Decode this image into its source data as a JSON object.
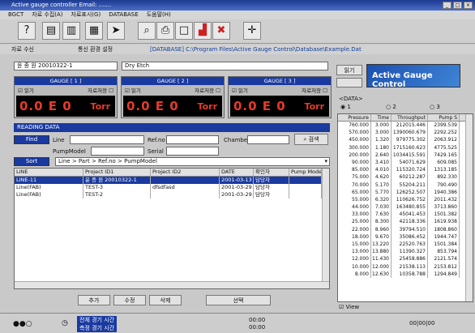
{
  "window": {
    "title": "Active gauge controller  Email: ......."
  },
  "menu": [
    "BGCT",
    "자료 수집(A)",
    "자료표시(G)",
    "DATABASE",
    "도움말(H)"
  ],
  "toolbar": {
    "icons": [
      "help-icon",
      "database-icon",
      "sheet-icon",
      "export-icon",
      "search-icon",
      "chart-icon",
      "display-icon",
      "close-icon",
      "crosshair-icon"
    ]
  },
  "pathbar": {
    "item1": "자료 수신",
    "item2": "통신 환경 설정",
    "path": "[DATABASE] C:\\Program Files\\Active Gauge Control\\Database\\Example.Dat"
  },
  "header": {
    "name": "윤 종 원 20010322-1",
    "process": "Dry Etch"
  },
  "gauges": [
    {
      "title": "GAUGE [ 1 ]",
      "read": "읽기",
      "save": "자료저장",
      "value": "0.0 E 0",
      "unit": "Torr"
    },
    {
      "title": "GAUGE [ 2 ]",
      "read": "읽기",
      "save": "자료저장",
      "value": "0.0 E 0",
      "unit": "Torr"
    },
    {
      "title": "GAUGE [ 3 ]",
      "read": "읽기",
      "save": "자료저장",
      "value": "0.0 E 0",
      "unit": "Torr"
    }
  ],
  "reading": {
    "title": "READING DATA",
    "find": "Find",
    "line": "Line",
    "refno": "Ref.no",
    "chamber": "Chamber",
    "pumpmodel": "PumpModel",
    "serial": "Serial",
    "search": "검색",
    "sort": "Sort",
    "sort_value": "Line > Part > Ref.no > PumpModel"
  },
  "grid": {
    "columns": [
      "LINE",
      "Project ID1",
      "Project ID2",
      "DATE",
      "확인자",
      "Pump Model"
    ],
    "rows": [
      {
        "line": "LINE-11",
        "id1": "윤 종 원 20010322-1",
        "id2": "",
        "date": "2001-03-13",
        "who": "담당자",
        "pump": ""
      },
      {
        "line": "Line(FAB)",
        "id1": "TEST-3",
        "id2": "dfsdfasd",
        "date": "2001-03-29",
        "who": "담당자",
        "pump": ""
      },
      {
        "line": "Line(FAB)",
        "id1": "TEST-2",
        "id2": "",
        "date": "2001-03-29",
        "who": "담당자",
        "pump": ""
      }
    ]
  },
  "buttons": {
    "add": "추가",
    "edit": "수정",
    "delete": "삭제",
    "select": "선택"
  },
  "right": {
    "read": "읽기",
    "logo": "Active Gauge Control",
    "data_label": "<DATA>",
    "radios": [
      "1",
      "2",
      "3"
    ],
    "view": "View"
  },
  "datatable": {
    "columns": [
      "Pressure",
      "Time",
      "Throughput",
      "Pump S"
    ],
    "rows": [
      [
        "760.000",
        "3.000",
        "212015.446",
        "2399.539"
      ],
      [
        "570.000",
        "3.000",
        "1390060.679",
        "2292.252"
      ],
      [
        "450.000",
        "1.320",
        "979775.302",
        "2063.912"
      ],
      [
        "300.000",
        "1.180",
        "1715160.623",
        "4775.525"
      ],
      [
        "200.000",
        "2.640",
        "1034415.591",
        "7429.165"
      ],
      [
        "90.000",
        "3.410",
        "54071.629",
        "609.085"
      ],
      [
        "85.000",
        "4.010",
        "115320.724",
        "1313.185"
      ],
      [
        "75.000",
        "4.620",
        "60212.287",
        "892.330"
      ],
      [
        "70.000",
        "5.170",
        "55204.211",
        "790.490"
      ],
      [
        "65.000",
        "5.770",
        "126252.507",
        "1940.386"
      ],
      [
        "55.000",
        "6.320",
        "110626.752",
        "2011.432"
      ],
      [
        "44.000",
        "7.030",
        "163480.855",
        "3713.860"
      ],
      [
        "33.000",
        "7.630",
        "45041.453",
        "1501.382"
      ],
      [
        "25.000",
        "8.300",
        "42118.336",
        "1619.938"
      ],
      [
        "22.000",
        "8.960",
        "39794.510",
        "1808.860"
      ],
      [
        "18.000",
        "9.670",
        "35086.452",
        "1944.747"
      ],
      [
        "15.000",
        "13.220",
        "22520.763",
        "1501.384"
      ],
      [
        "13.000",
        "13.880",
        "11390.327",
        "853.794"
      ],
      [
        "12.000",
        "11.430",
        "25458.886",
        "2121.574"
      ],
      [
        "10.000",
        "12.000",
        "21538.113",
        "2153.812"
      ],
      [
        "8.000",
        "12.630",
        "10358.788",
        "1294.849"
      ]
    ]
  },
  "status": {
    "time1_label": "전체 경기 시간",
    "time2_label": "측정 경기 시간",
    "time1": "00:00",
    "time2": "00:00",
    "right": "00|00|00"
  }
}
